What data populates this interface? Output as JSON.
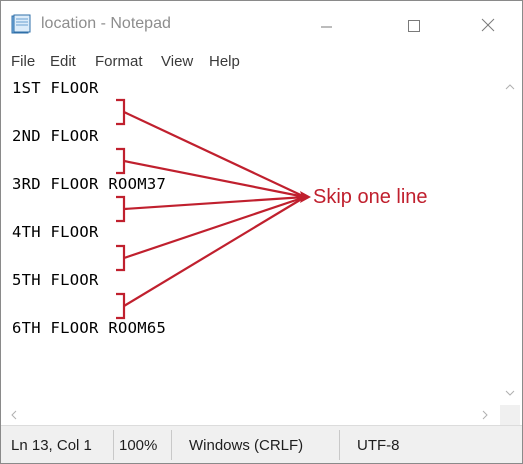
{
  "window": {
    "title": "location - Notepad",
    "app_icon": "notepad-icon",
    "controls": [
      "minimize-icon",
      "maximize-icon",
      "close-icon"
    ]
  },
  "menu": [
    "File",
    "Edit",
    "Format",
    "View",
    "Help"
  ],
  "editor": {
    "lines": [
      "1ST FLOOR",
      "",
      "2ND FLOOR",
      "",
      "3RD FLOOR ROOM37",
      "",
      "4TH FLOOR",
      "",
      "5TH FLOOR",
      "",
      "6TH FLOOR ROOM65"
    ]
  },
  "annotation": {
    "text": "Skip one line",
    "color": "#c0202e"
  },
  "statusbar": {
    "position": "Ln 13, Col 1",
    "zoom": "100%",
    "line_ending": "Windows (CRLF)",
    "encoding": "UTF-8"
  },
  "colors": {
    "title_text": "#8d8d8d",
    "status_bg": "#f0f0f0"
  }
}
